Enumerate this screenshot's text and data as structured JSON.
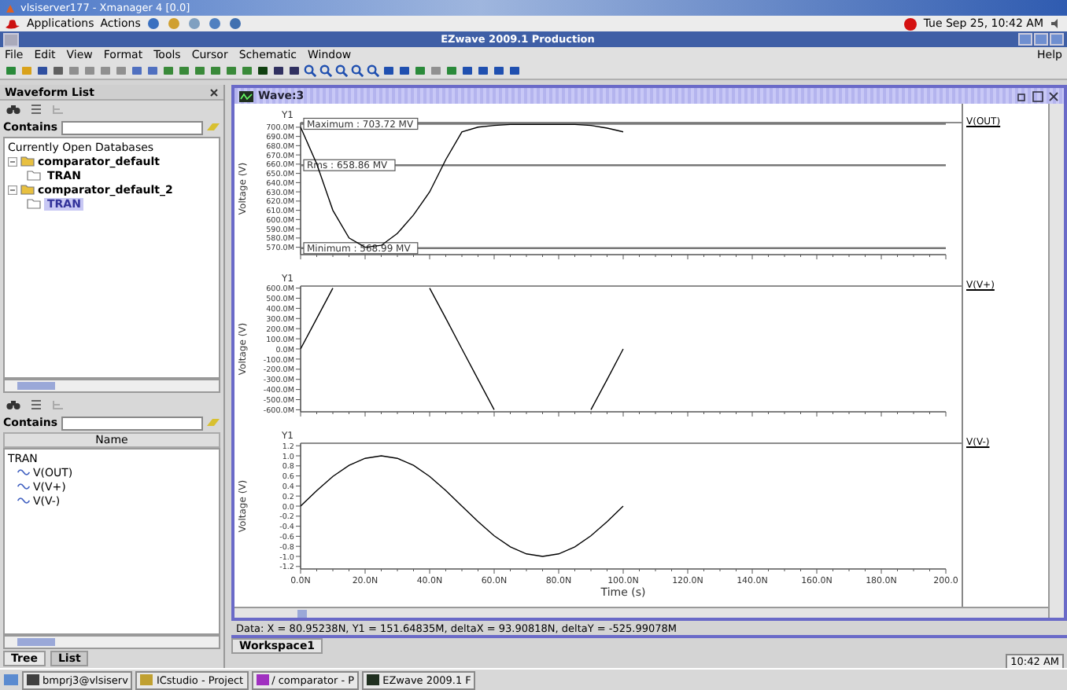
{
  "xmanager_title": "vlsiserver177 - Xmanager 4 [0.0]",
  "gnome_panel": {
    "menus": [
      "Applications",
      "Actions"
    ],
    "clock": "Tue Sep 25, 10:42 AM"
  },
  "window": {
    "title": "EZwave 2009.1 Production"
  },
  "menu": [
    "File",
    "Edit",
    "View",
    "Format",
    "Tools",
    "Cursor",
    "Schematic",
    "Window"
  ],
  "help_menu": "Help",
  "waveform_list": {
    "title": "Waveform List",
    "filter_label": "Contains",
    "tree_heading": "Currently Open Databases",
    "databases": [
      {
        "name": "comparator_default",
        "expanded": true,
        "children": [
          {
            "name": "TRAN",
            "selected": false
          }
        ]
      },
      {
        "name": "comparator_default_2",
        "expanded": true,
        "children": [
          {
            "name": "TRAN",
            "selected": true
          }
        ]
      }
    ]
  },
  "signal_list": {
    "filter_label": "Contains",
    "column": "Name",
    "items": [
      {
        "name": "TRAN",
        "children": [
          {
            "name": "V(OUT)"
          },
          {
            "name": "V(V+)"
          },
          {
            "name": "V(V-)"
          }
        ]
      }
    ]
  },
  "bottom_tabs": [
    {
      "label": "Tree",
      "selected": true
    },
    {
      "label": "List",
      "selected": false
    }
  ],
  "wave_window": {
    "title": "Wave:3",
    "charts": [
      {
        "chart_data": {
          "type": "line",
          "title": "Y1",
          "ylabel": "Voltage (V)",
          "x": [
            0,
            5,
            10,
            15,
            20,
            25,
            30,
            35,
            40,
            45,
            50,
            55,
            60,
            65,
            70,
            75,
            80,
            85,
            90,
            95,
            100
          ],
          "xlim": [
            0,
            200
          ],
          "ylim": [
            562,
            705
          ],
          "series": [
            {
              "name": "V(OUT)",
              "color": "#000000",
              "values": [
                700,
                660,
                610,
                580,
                570,
                572,
                585,
                605,
                630,
                665,
                695,
                700,
                702,
                703,
                703,
                703,
                703,
                703,
                702,
                699,
                695
              ]
            }
          ],
          "yticks": [
            {
              "value": 700,
              "label": "700.0M"
            },
            {
              "value": 690,
              "label": "690.0M"
            },
            {
              "value": 680,
              "label": "680.0M"
            },
            {
              "value": 670,
              "label": "670.0M"
            },
            {
              "value": 660,
              "label": "660.0M"
            },
            {
              "value": 650,
              "label": "650.0M"
            },
            {
              "value": 640,
              "label": "640.0M"
            },
            {
              "value": 630,
              "label": "630.0M"
            },
            {
              "value": 620,
              "label": "620.0M"
            },
            {
              "value": 610,
              "label": "610.0M"
            },
            {
              "value": 600,
              "label": "600.0M"
            },
            {
              "value": 590,
              "label": "590.0M"
            },
            {
              "value": 580,
              "label": "580.0M"
            },
            {
              "value": 570,
              "label": "570.0M"
            }
          ],
          "ref_lines": [
            {
              "axis": "y",
              "value": 703.72,
              "label": "Maximum : 703.72 MV"
            },
            {
              "axis": "y",
              "value": 658.86,
              "label": "Rms : 658.86 MV"
            },
            {
              "axis": "y",
              "value": 568.99,
              "label": "Minimum : 568.99 MV"
            }
          ]
        }
      },
      {
        "chart_data": {
          "type": "line",
          "title": "Y1",
          "ylabel": "Voltage (V)",
          "x": [
            0,
            5,
            10,
            15,
            20,
            25,
            30,
            35,
            40,
            45,
            50,
            55,
            60,
            65,
            70,
            75,
            80,
            85,
            90,
            95,
            100
          ],
          "xlim": [
            0,
            200
          ],
          "ylim": [
            -620,
            620
          ],
          "series": [
            {
              "name": "V(V+)",
              "color": "#000000",
              "values": [
                0,
                300,
                600,
                null,
                null,
                null,
                null,
                null,
                600,
                300,
                0,
                -300,
                -600,
                null,
                null,
                null,
                null,
                null,
                -600,
                -300,
                0
              ]
            }
          ],
          "yticks": [
            {
              "value": 600,
              "label": "600.0M"
            },
            {
              "value": 500,
              "label": "500.0M"
            },
            {
              "value": 400,
              "label": "400.0M"
            },
            {
              "value": 300,
              "label": "300.0M"
            },
            {
              "value": 200,
              "label": "200.0M"
            },
            {
              "value": 100,
              "label": "100.0M"
            },
            {
              "value": 0,
              "label": "0.0M"
            },
            {
              "value": -100,
              "label": "-100.0M"
            },
            {
              "value": -200,
              "label": "-200.0M"
            },
            {
              "value": -300,
              "label": "-300.0M"
            },
            {
              "value": -400,
              "label": "-400.0M"
            },
            {
              "value": -500,
              "label": "-500.0M"
            },
            {
              "value": -600,
              "label": "-600.0M"
            }
          ]
        }
      },
      {
        "chart_data": {
          "type": "line",
          "title": "Y1",
          "ylabel": "Voltage (V)",
          "xlabel": "Time (s)",
          "x": [
            0,
            5,
            10,
            15,
            20,
            25,
            30,
            35,
            40,
            45,
            50,
            55,
            60,
            65,
            70,
            75,
            80,
            85,
            90,
            95,
            100
          ],
          "xlim": [
            0,
            200
          ],
          "ylim": [
            -1.25,
            1.25
          ],
          "series": [
            {
              "name": "V(V-)",
              "color": "#000000",
              "values": [
                0,
                0.31,
                0.59,
                0.81,
                0.95,
                1,
                0.95,
                0.81,
                0.59,
                0.31,
                0,
                -0.31,
                -0.59,
                -0.81,
                -0.95,
                -1,
                -0.95,
                -0.81,
                -0.59,
                -0.31,
                0
              ]
            }
          ],
          "yticks": [
            {
              "value": 1.2,
              "label": "1.2"
            },
            {
              "value": 1.0,
              "label": "1.0"
            },
            {
              "value": 0.8,
              "label": "0.8"
            },
            {
              "value": 0.6,
              "label": "0.6"
            },
            {
              "value": 0.4,
              "label": "0.4"
            },
            {
              "value": 0.2,
              "label": "0.2"
            },
            {
              "value": 0,
              "label": "0.0"
            },
            {
              "value": -0.2,
              "label": "-0.2"
            },
            {
              "value": -0.4,
              "label": "-0.4"
            },
            {
              "value": -0.6,
              "label": "-0.6"
            },
            {
              "value": -0.8,
              "label": "-0.8"
            },
            {
              "value": -1.0,
              "label": "-1.0"
            },
            {
              "value": -1.2,
              "label": "-1.2"
            }
          ],
          "xticks": [
            {
              "value": 0,
              "label": "0.0N"
            },
            {
              "value": 20,
              "label": "20.0N"
            },
            {
              "value": 40,
              "label": "40.0N"
            },
            {
              "value": 60,
              "label": "60.0N"
            },
            {
              "value": 80,
              "label": "80.0N"
            },
            {
              "value": 100,
              "label": "100.0N"
            },
            {
              "value": 120,
              "label": "120.0N"
            },
            {
              "value": 140,
              "label": "140.0N"
            },
            {
              "value": 160,
              "label": "160.0N"
            },
            {
              "value": 180,
              "label": "180.0N"
            },
            {
              "value": 200,
              "label": "200.0"
            }
          ]
        }
      }
    ]
  },
  "data_readout": "Data: X = 80.95238N, Y1 = 151.64835M, deltaX = 93.90818N, deltaY = -525.99078M",
  "workspace_tab": "Workspace1",
  "status_time": "10:42 AM",
  "taskbar": [
    {
      "label": "bmprj3@vlsiserv"
    },
    {
      "label": "ICstudio - Project"
    },
    {
      "label": "/  comparator - P"
    },
    {
      "label": "EZwave 2009.1 F"
    }
  ]
}
